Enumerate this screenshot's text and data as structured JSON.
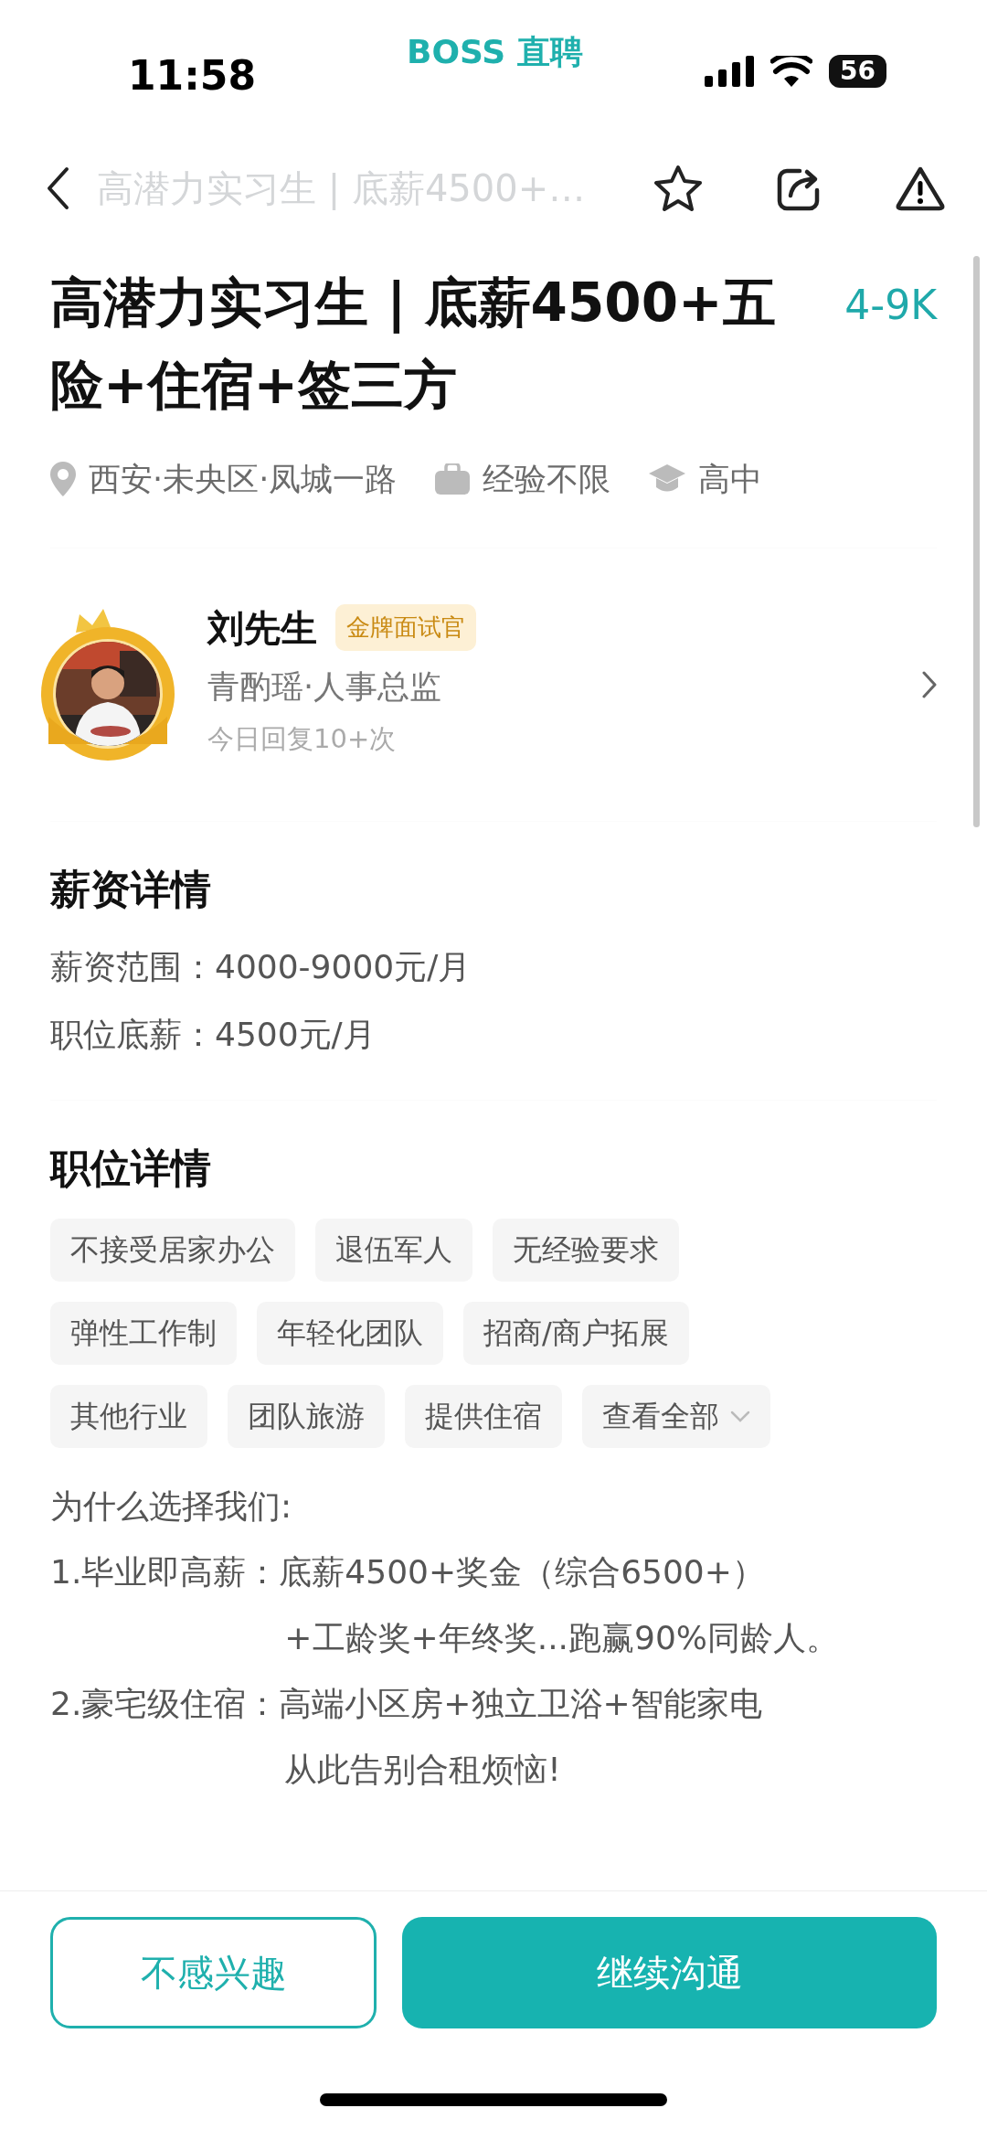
{
  "status_bar": {
    "time": "11:58",
    "app_name": "BOSS 直聘",
    "battery": "56"
  },
  "nav": {
    "title": "高潜力实习生 | 底薪4500+…"
  },
  "job": {
    "title": "高潜力实习生 | 底薪4500+五险+住宿+签三方",
    "salary": "4-9K",
    "meta": [
      {
        "kind": "location",
        "text": "西安·未央区·凤城一路"
      },
      {
        "kind": "experience",
        "text": "经验不限"
      },
      {
        "kind": "education",
        "text": "高中"
      }
    ]
  },
  "recruiter": {
    "name": "刘先生",
    "badge": "金牌面试官",
    "company": "青酌瑶·人事总监",
    "reply": "今日回复10+次"
  },
  "salary_details": {
    "heading": "薪资详情",
    "lines": [
      "薪资范围：4000-9000元/月",
      "职位底薪：4500元/月"
    ]
  },
  "job_details": {
    "heading": "职位详情",
    "tags": [
      {
        "kind": "tag",
        "text": "不接受居家办公"
      },
      {
        "kind": "tag",
        "text": "退伍军人"
      },
      {
        "kind": "tag",
        "text": "无经验要求"
      },
      {
        "kind": "tag",
        "text": "弹性工作制"
      },
      {
        "kind": "tag",
        "text": "年轻化团队"
      },
      {
        "kind": "tag",
        "text": "招商/商户拓展"
      },
      {
        "kind": "tag",
        "text": "其他行业"
      },
      {
        "kind": "tag",
        "text": "团队旅游"
      },
      {
        "kind": "tag",
        "text": "提供住宿"
      },
      {
        "kind": "expand",
        "text": "查看全部"
      }
    ],
    "intro": "为什么选择我们:",
    "reasons": [
      {
        "label": "1.毕业即高薪：",
        "lines": [
          "底薪4500+奖金（综合6500+）",
          "+工龄奖+年终奖...跑赢90%同龄人。"
        ]
      },
      {
        "label": "2.豪宅级住宿：",
        "lines": [
          "高端小区房+独立卫浴+智能家电",
          "从此告别合租烦恼!"
        ]
      }
    ]
  },
  "actions": [
    {
      "kind": "secondary",
      "label": "不感兴趣"
    },
    {
      "kind": "primary",
      "label": "继续沟通"
    }
  ]
}
